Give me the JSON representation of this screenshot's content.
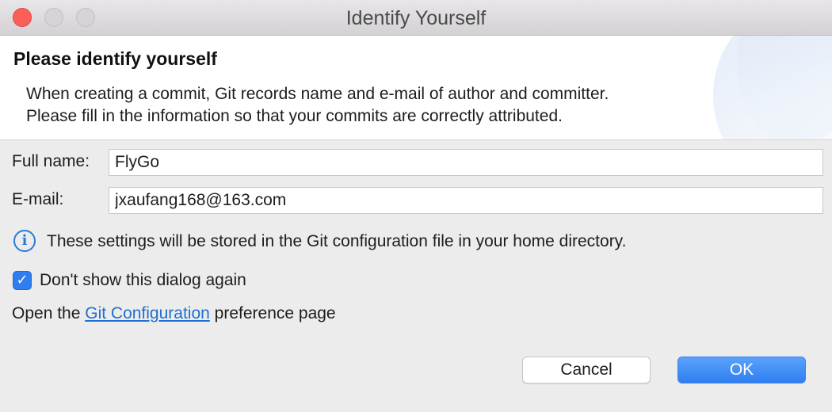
{
  "window": {
    "title": "Identify Yourself"
  },
  "header": {
    "title": "Please identify yourself",
    "description_line1": "When creating a commit, Git records name and e-mail of author and committer.",
    "description_line2": "Please fill in the information so that your commits are correctly attributed."
  },
  "form": {
    "full_name_label": "Full name:",
    "full_name_value": "FlyGo",
    "email_label": "E-mail:",
    "email_value": "jxaufang168@163.com"
  },
  "info": {
    "icon": "info-icon",
    "text": "These settings will be stored in the Git configuration file in your home directory."
  },
  "checkbox": {
    "label": "Don't show this dialog again",
    "checked": true
  },
  "preference": {
    "prefix": "Open the ",
    "link": "Git Configuration",
    "suffix": " preference page"
  },
  "buttons": {
    "cancel": "Cancel",
    "ok": "OK"
  },
  "colors": {
    "accent": "#2f7ef0",
    "link": "#1f6fd1",
    "close": "#fc5f57"
  }
}
